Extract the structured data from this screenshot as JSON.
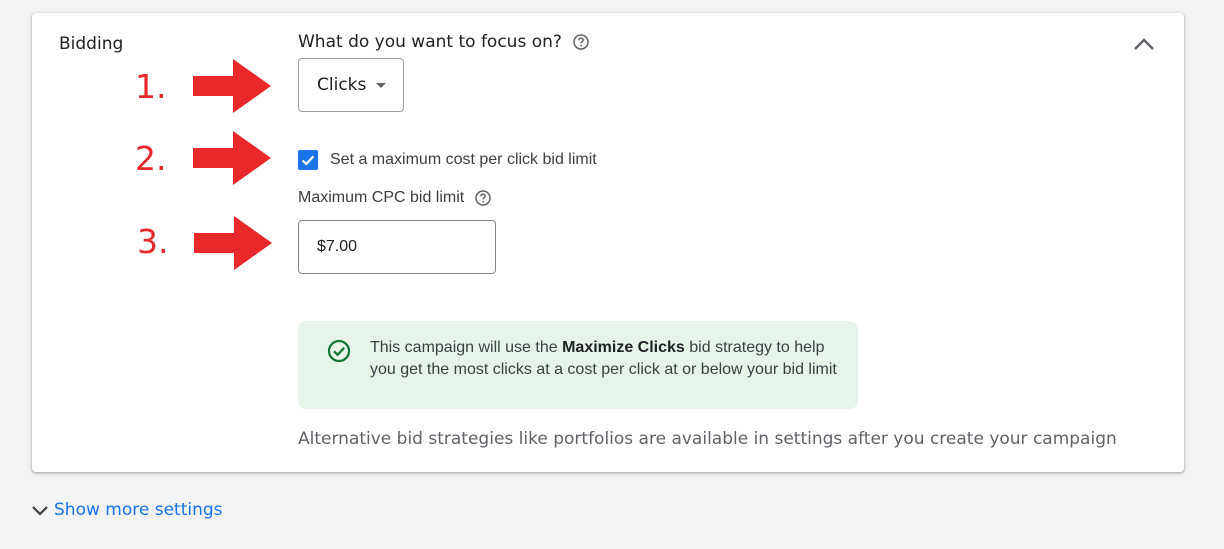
{
  "section": {
    "title": "Bidding",
    "question": "What do you want to focus on?",
    "focus_value": "Clicks",
    "checkbox_label": "Set a maximum cost per click bid limit",
    "checkbox_checked": true,
    "cpc_label": "Maximum CPC bid limit",
    "cpc_value": "$7.00",
    "info": {
      "prefix": "This campaign will use the ",
      "strategy": "Maximize Clicks",
      "suffix": " bid strategy to help you get the most clicks at a cost per click at or below your bid limit"
    },
    "alternative_text": "Alternative bid strategies like portfolios are available in settings after you create your campaign"
  },
  "annotations": [
    "1.",
    "2.",
    "3."
  ],
  "footer": {
    "show_more": "Show more settings"
  },
  "colors": {
    "accent": "#1a73e8",
    "annotation": "#e8282b",
    "success_bg": "#e6f4ea",
    "success_icon": "#137333"
  },
  "icons": [
    "help-icon",
    "chevron-up-icon",
    "dropdown-caret-icon",
    "check-icon",
    "check-circle-icon",
    "chevron-down-icon"
  ]
}
